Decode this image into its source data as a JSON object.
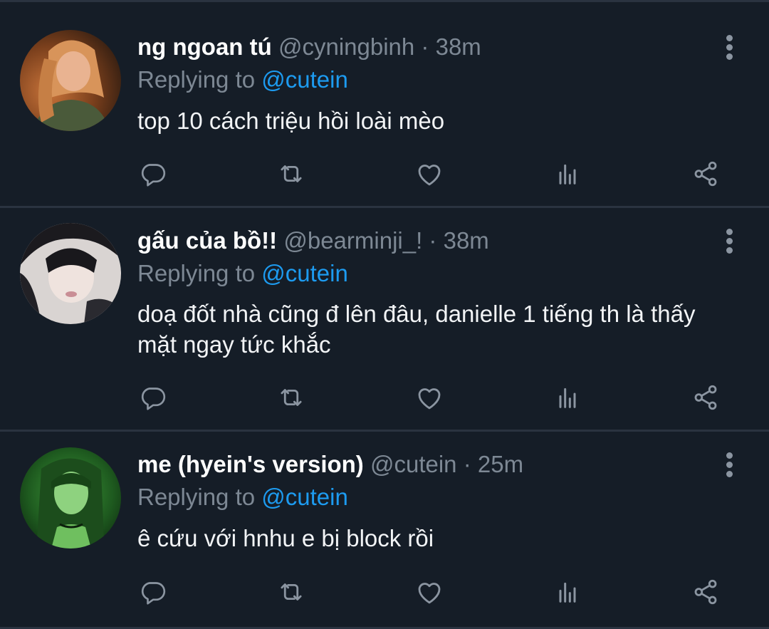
{
  "tweets": [
    {
      "display_name": "ng ngoan tú",
      "handle": "@cyningbinh",
      "separator": "·",
      "time": "38m",
      "replying_prefix": "Replying to",
      "replying_to": "@cutein",
      "text": "top 10 cách triệu hồi loài mèo",
      "avatar_desc": "photo-avatar-orange"
    },
    {
      "display_name": "gấu của bồ!!",
      "handle": "@bearminji_!",
      "separator": "·",
      "time": "38m",
      "replying_prefix": "Replying to",
      "replying_to": "@cutein",
      "text": "doạ đốt nhà cũng đ lên đâu, danielle 1 tiếng th là thấy mặt ngay tức khắc",
      "avatar_desc": "photo-avatar-mono"
    },
    {
      "display_name": "me (hyein's version)",
      "handle": "@cutein",
      "separator": "·",
      "time": "25m",
      "replying_prefix": "Replying to",
      "replying_to": "@cutein",
      "text": "ê cứu với hnhu e bị block rồi",
      "avatar_desc": "photo-avatar-green"
    }
  ],
  "actions": [
    "reply-icon",
    "retweet-icon",
    "like-icon",
    "analytics-icon",
    "share-icon"
  ],
  "colors": {
    "background": "#151d27",
    "divider": "#2a3340",
    "muted_text": "#7d8894",
    "mention": "#1d9bf0",
    "icon": "#8b95a1"
  }
}
